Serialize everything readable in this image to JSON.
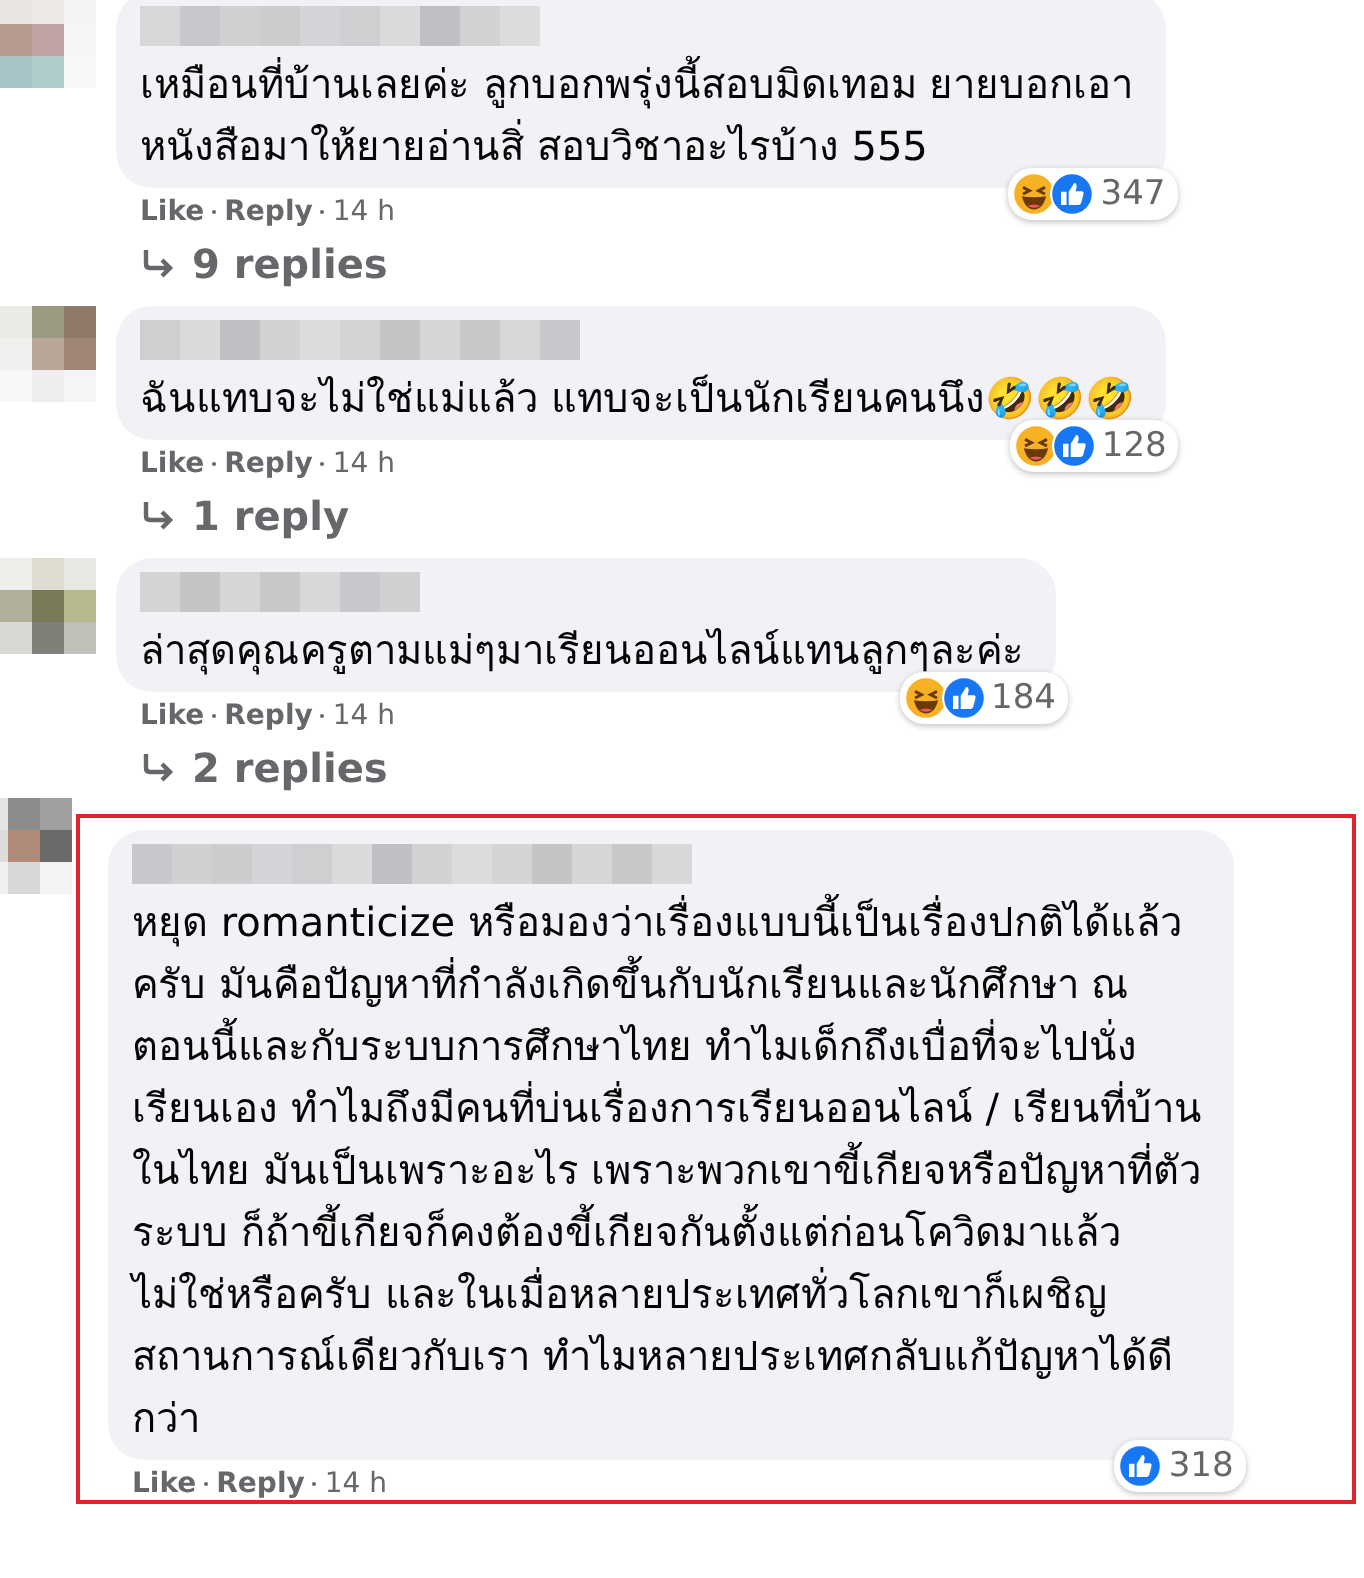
{
  "comments": [
    {
      "highlighted": false,
      "text": "เหมือนที่บ้านเลยค่ะ ลูกบอกพรุ่งนี้สอบมิดเทอม ยายบอกเอา\nหนังสือมาให้ยายอ่านสิ่ สอบวิชาอะไรบ้าง 555",
      "reactions": [
        {
          "kind": "haha"
        },
        {
          "kind": "like"
        }
      ],
      "reaction_count": "347",
      "actions": [
        "Like",
        "Reply"
      ],
      "time": "14 h",
      "replies": "9 replies"
    },
    {
      "highlighted": false,
      "text": "ฉันแทบจะไม่ใช่แม่แล้ว แทบจะเป็นนักเรียนคนนึง🤣🤣🤣",
      "reactions": [
        {
          "kind": "haha"
        },
        {
          "kind": "like"
        }
      ],
      "reaction_count": "128",
      "actions": [
        "Like",
        "Reply"
      ],
      "time": "14 h",
      "replies": "1 reply"
    },
    {
      "highlighted": false,
      "text": "ล่าสุดคุณครูตามแม่ๆมาเรียนออนไลน์แทนลูกๆละค่ะ",
      "reactions": [
        {
          "kind": "haha"
        },
        {
          "kind": "like"
        }
      ],
      "reaction_count": "184",
      "actions": [
        "Like",
        "Reply"
      ],
      "time": "14 h",
      "replies": "2 replies"
    },
    {
      "highlighted": true,
      "text": "หยุด romanticize หรือมองว่าเรื่องแบบนี้เป็นเรื่องปกติได้แล้ว\nครับ มันคือปัญหาที่กำลังเกิดขึ้นกับนักเรียนและนักศึกษา ณ\nตอนนี้และกับระบบการศึกษาไทย ทำไมเด็กถึงเบื่อที่จะไปนั่ง\nเรียนเอง ทำไมถึงมีคนที่บ่นเรื่องการเรียนออนไลน์ / เรียนที่บ้าน\nในไทย มันเป็นเพราะอะไร เพราะพวกเขาขี้เกียจหรือปัญหาที่ตัว\nระบบ ก็ถ้าขี้เกียจก็คงต้องขี้เกียจกันตั้งแต่ก่อนโควิดมาแล้ว\nไม่ใช่หรือครับ และในเมื่อหลายประเทศทั่วโลกเขาก็เผชิญ\nสถานการณ์เดียวกับเรา ทำไมหลายประเทศกลับแก้ปัญหาได้ดี\nกว่า",
      "reactions": [
        {
          "kind": "like"
        }
      ],
      "reaction_count": "318",
      "actions": [
        "Like",
        "Reply"
      ],
      "time": "14 h"
    }
  ]
}
